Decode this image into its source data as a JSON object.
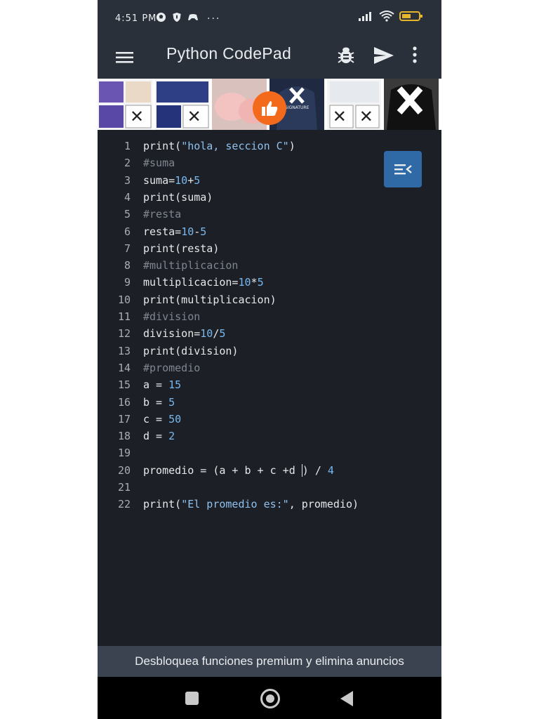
{
  "status_bar": {
    "time": "4:51 PM",
    "icons_left": [
      "soccer-ball-icon",
      "shield-icon",
      "gamepad-icon",
      "more-dots-icon"
    ],
    "icons_right": [
      "signal-icon",
      "wifi-icon",
      "battery-icon"
    ],
    "more_dots": "···"
  },
  "app_bar": {
    "title": "Python CodePad",
    "actions": [
      "menu-icon",
      "bug-icon",
      "send-icon",
      "more-vert-icon"
    ]
  },
  "ad_strip": {
    "items": [
      {
        "name": "bedding-purple"
      },
      {
        "name": "bedding-navy"
      },
      {
        "name": "pink-slippers"
      },
      {
        "name": "hoodie-navy"
      },
      {
        "name": "bedding-white"
      },
      {
        "name": "hoodie-black"
      }
    ],
    "like_button": "thumbs-up-icon",
    "close_mark": "✕",
    "hoodie_text": "SIGNATURE",
    "accent": "#f36a1c"
  },
  "editor": {
    "lines": [
      {
        "n": "1",
        "parts": [
          {
            "t": "print(",
            "c": "op"
          },
          {
            "t": "\"hola, seccion C\"",
            "c": "str"
          },
          {
            "t": ")",
            "c": "op"
          }
        ]
      },
      {
        "n": "2",
        "parts": [
          {
            "t": "#suma",
            "c": "cmt"
          }
        ]
      },
      {
        "n": "3",
        "parts": [
          {
            "t": "suma=",
            "c": "op"
          },
          {
            "t": "10",
            "c": "num"
          },
          {
            "t": "+",
            "c": "op"
          },
          {
            "t": "5",
            "c": "num"
          }
        ]
      },
      {
        "n": "4",
        "parts": [
          {
            "t": "print(suma)",
            "c": "op"
          }
        ]
      },
      {
        "n": "5",
        "parts": [
          {
            "t": "#resta",
            "c": "cmt"
          }
        ]
      },
      {
        "n": "6",
        "parts": [
          {
            "t": "resta=",
            "c": "op"
          },
          {
            "t": "10",
            "c": "num"
          },
          {
            "t": "-",
            "c": "op"
          },
          {
            "t": "5",
            "c": "num"
          }
        ]
      },
      {
        "n": "7",
        "parts": [
          {
            "t": "print(resta)",
            "c": "op"
          }
        ]
      },
      {
        "n": "8",
        "parts": [
          {
            "t": "#multiplicacion",
            "c": "cmt"
          }
        ]
      },
      {
        "n": "9",
        "parts": [
          {
            "t": "multiplicacion=",
            "c": "op"
          },
          {
            "t": "10",
            "c": "num"
          },
          {
            "t": "*",
            "c": "op"
          },
          {
            "t": "5",
            "c": "num"
          }
        ]
      },
      {
        "n": "10",
        "parts": [
          {
            "t": "print(multiplicacion)",
            "c": "op"
          }
        ]
      },
      {
        "n": "11",
        "parts": [
          {
            "t": "#division",
            "c": "cmt"
          }
        ]
      },
      {
        "n": "12",
        "parts": [
          {
            "t": "division=",
            "c": "op"
          },
          {
            "t": "10",
            "c": "num"
          },
          {
            "t": "/",
            "c": "op"
          },
          {
            "t": "5",
            "c": "num"
          }
        ]
      },
      {
        "n": "13",
        "parts": [
          {
            "t": "print(division)",
            "c": "op"
          }
        ]
      },
      {
        "n": "14",
        "parts": [
          {
            "t": "#promedio",
            "c": "cmt"
          }
        ]
      },
      {
        "n": "15",
        "parts": [
          {
            "t": "a = ",
            "c": "op"
          },
          {
            "t": "15",
            "c": "num"
          }
        ]
      },
      {
        "n": "16",
        "parts": [
          {
            "t": "b = ",
            "c": "op"
          },
          {
            "t": "5",
            "c": "num"
          }
        ]
      },
      {
        "n": "17",
        "parts": [
          {
            "t": "c = ",
            "c": "op"
          },
          {
            "t": "50",
            "c": "num"
          }
        ]
      },
      {
        "n": "18",
        "parts": [
          {
            "t": "d = ",
            "c": "op"
          },
          {
            "t": "2",
            "c": "num"
          }
        ]
      },
      {
        "n": "19",
        "parts": []
      },
      {
        "n": "20",
        "parts": [
          {
            "t": "promedio = (a + b + c +d ",
            "c": "op"
          },
          {
            "t": "|",
            "c": "cursor"
          },
          {
            "t": ") / ",
            "c": "op"
          },
          {
            "t": "4",
            "c": "num"
          }
        ]
      },
      {
        "n": "21",
        "parts": []
      },
      {
        "n": "22",
        "parts": [
          {
            "t": "print(",
            "c": "op"
          },
          {
            "t": "\"El promedio es:\"",
            "c": "str"
          },
          {
            "t": ", promedio)",
            "c": "op"
          }
        ]
      }
    ],
    "colors": {
      "string": "#8fc0ee",
      "number": "#78b8f0",
      "comment": "#7f8690",
      "text": "#e6e8ea",
      "line_number": "#a8adb5",
      "background": "#1c2026"
    },
    "fab_icon": "collapse-menu-icon"
  },
  "premium_banner": {
    "text": "Desbloquea funciones premium y elimina anuncios"
  },
  "nav_bar": {
    "buttons": [
      "recents-square-icon",
      "home-circle-icon",
      "back-triangle-icon"
    ]
  }
}
